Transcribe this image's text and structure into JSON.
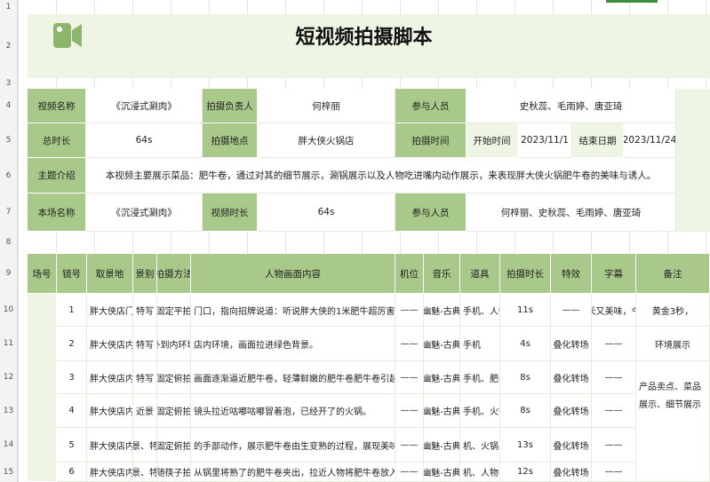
{
  "row_numbers": [
    "1",
    "2",
    "3",
    "4",
    "5",
    "6",
    "7",
    "8",
    "9",
    "10",
    "11",
    "12",
    "13",
    "14",
    "15"
  ],
  "title": "短视频拍摄脚本",
  "icon": "video-camera-icon",
  "info": {
    "r4": [
      "视频名称",
      "《沉浸式涮肉》",
      "拍摄负责人",
      "何梓丽",
      "参与人员",
      "史秋蕊、毛雨婷、唐亚琦"
    ],
    "r5": [
      "总时长",
      "64s",
      "拍摄地点",
      "胖大侠火锅店",
      "拍摄时间",
      "开始时间",
      "2023/11/1",
      "结束日期",
      "2023/11/24"
    ],
    "r6": [
      "主题介绍",
      "本视频主要展示菜品：肥牛卷，通过对其的细节展示，涮锅展示以及人物吃进嘴内动作展示，来表现胖大侠火锅肥牛卷的美味与诱人。"
    ],
    "r7": [
      "本场名称",
      "《沉浸式涮肉》",
      "视频时长",
      "64s",
      "参与人员",
      "何梓丽、史秋蕊、毛雨婷、唐亚琦"
    ]
  },
  "table": {
    "headers": [
      "场号",
      "镜号",
      "取景地",
      "景别",
      "拍摄方法",
      "人物画面内容",
      "机位",
      "音乐",
      "道具",
      "拍摄时长",
      "特效",
      "字幕",
      "备注"
    ],
    "rows": [
      [
        "",
        "1",
        "胖大侠店门口",
        "特写",
        "固定平拍",
        "门口，指向招牌说道：听说胖大侠的1米肥牛超厉害，我们",
        "——",
        "幽魅-古典",
        "手机、人物",
        "11s",
        "——",
        "又长又美味，今天",
        "黄金3秒，"
      ],
      [
        "",
        "2",
        "胖大侠店内景",
        "特写",
        "外到内环境",
        "店内环境，画面拉进绿色背景。",
        "——",
        "幽魅-古典",
        "手机",
        "4s",
        "叠化转场",
        "——",
        "环境展示"
      ],
      [
        "",
        "3",
        "胖大侠店内",
        "特写",
        "固定俯拍",
        "画面逐渐逼近肥牛卷，轻薄鲜嫩的肥牛卷肥牛卷引起观众注意",
        "——",
        "幽魅-古典",
        "手机、肥牛卷",
        "8s",
        "叠化转场",
        "——",
        ""
      ],
      [
        "",
        "4",
        "胖大侠店内餐桌",
        "近景",
        "固定俯拍",
        "镜头拉近咕嘟咕嘟冒着泡，已经开了的火锅。",
        "——",
        "幽魅-古典",
        "手机、火锅",
        "8s",
        "叠化转场",
        "——",
        ""
      ],
      [
        "",
        "5",
        "胖大侠店内餐桌",
        "景、特",
        "固定俯拍",
        "的手部动作，展示肥牛卷由生变熟的过程，展现美味诱惑。",
        "——",
        "幽魅-古典",
        "机、火锅、肥牛",
        "13s",
        "叠化转场",
        "——",
        ""
      ],
      [
        "",
        "6",
        "胖大侠店内餐桌",
        "景、特",
        "随筷子拍",
        "从锅里将熟了的肥牛卷夹出，拉近人物将肥牛卷放入嘴内的画",
        "——",
        "幽魅-古典",
        "机、人物、肥牛",
        "12s",
        "叠化转场",
        "——",
        ""
      ]
    ],
    "merged_note": "产品卖点、菜品展示、细节展示"
  },
  "colors": {
    "header_green": "#a8c98a",
    "light_green": "#eef5e4",
    "accent": "#3d8b3d"
  }
}
